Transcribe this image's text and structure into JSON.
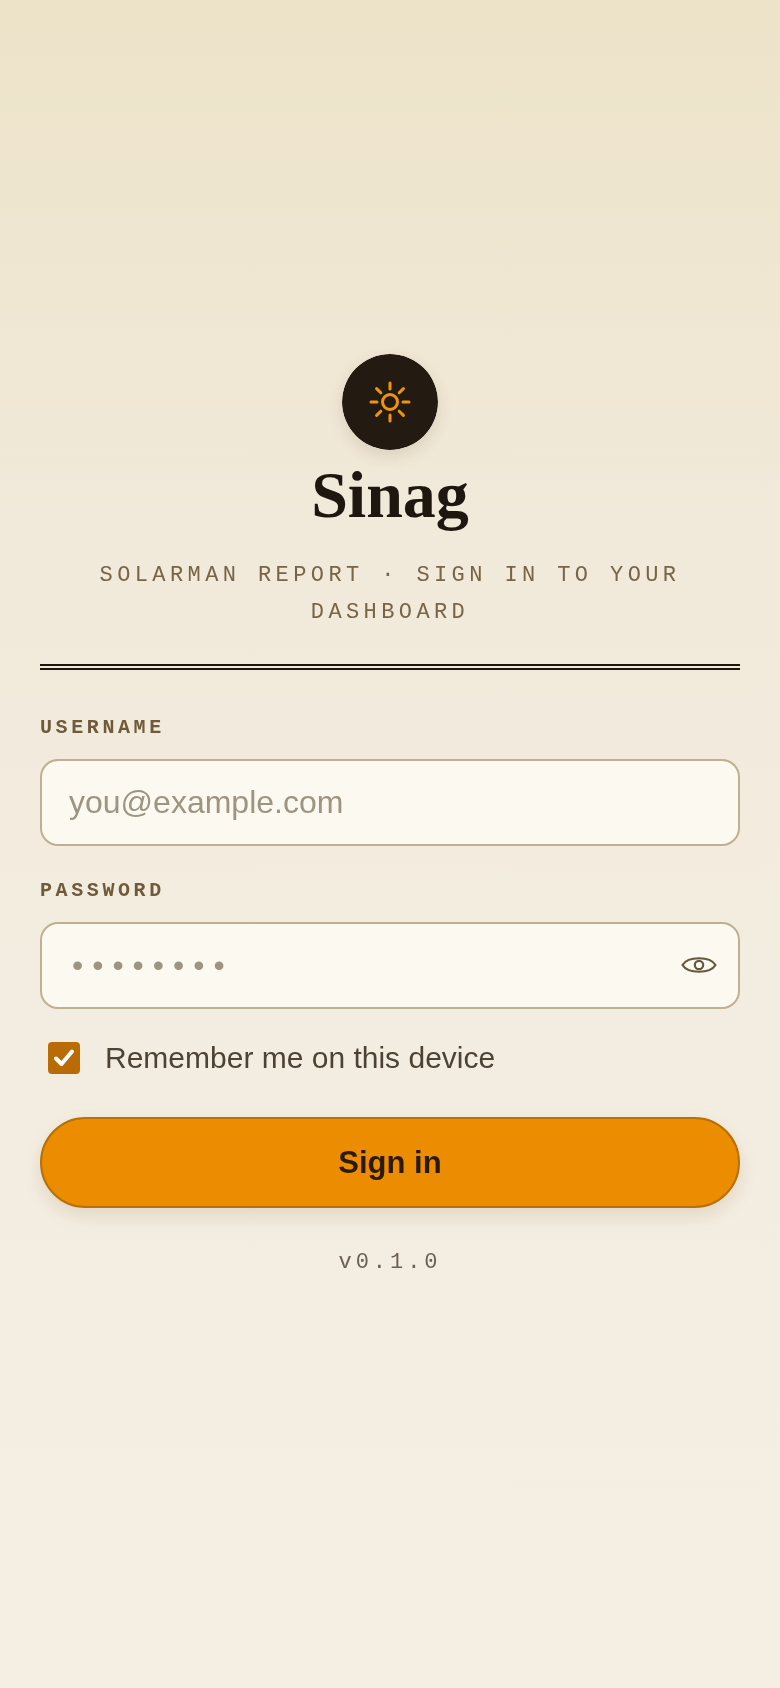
{
  "brand": {
    "title": "Sinag",
    "subtitle": "SOLARMAN REPORT · SIGN IN TO YOUR DASHBOARD"
  },
  "form": {
    "fields": [
      {
        "label": "USERNAME",
        "kind": "text",
        "placeholder": "you@example.com"
      },
      {
        "label": "PASSWORD",
        "kind": "password",
        "value": "••••••••"
      }
    ],
    "remember": {
      "label": "Remember me on this device",
      "checked": true
    },
    "submit": {
      "label": "Sign in"
    }
  },
  "version": "v0.1.0"
}
